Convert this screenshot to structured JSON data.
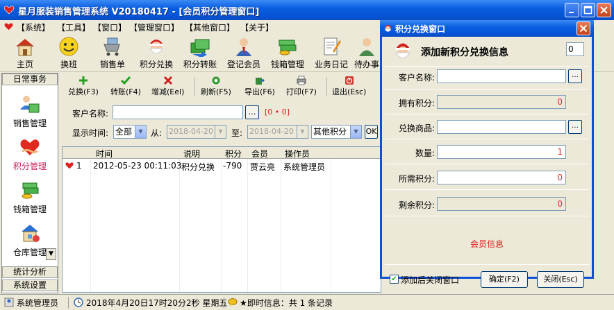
{
  "window": {
    "title": "星月服装销售管理系统 V20180417 - [会员积分管理窗口]"
  },
  "menu": [
    "【系统】",
    "【工具】",
    "【窗口】",
    "【管理窗口】",
    "【其他窗口】",
    "【关于】"
  ],
  "toolbar": [
    "主页",
    "换班",
    "销售单",
    "积分兑换",
    "积分转账",
    "登记会员",
    "钱箱管理",
    "业务日记",
    "待办事"
  ],
  "leftnav": {
    "header_top": "日常事务",
    "items": [
      "销售管理",
      "积分管理",
      "钱箱管理",
      "仓库管理"
    ],
    "footer": [
      "统计分析",
      "系统设置"
    ]
  },
  "inner_toolbar": [
    "兑换(F3)",
    "转账(F4)",
    "增减(Eel)",
    "刷新(F5)",
    "导出(F6)",
    "打印(F7)",
    "退出(Esc)"
  ],
  "filter": {
    "customer_label": "客户名称:",
    "customer_value": "",
    "points_display": "[0 • 0]",
    "time_label": "显示时间:",
    "time_option": "全部",
    "from_label": "从:",
    "from_date": "2018-04-20",
    "to_label": "至:",
    "to_date": "2018-04-20",
    "type_option": "其他积分",
    "ok_label": "OK"
  },
  "table": {
    "columns": [
      "时间",
      "说明",
      "积分",
      "会员",
      "操作员"
    ],
    "rows": [
      {
        "num": "1",
        "time": "2012-05-23 00:11:03",
        "desc": "积分兑换",
        "points": "-790",
        "member": "贾云亮",
        "operator": "系统管理员"
      }
    ]
  },
  "status": {
    "user": "系统管理员",
    "datetime": "2018年4月20日17时20分2秒 星期五",
    "info": "★即时信息：共 1 条记录"
  },
  "dialog": {
    "title": "积分兑换窗口",
    "heading": "添加新积分兑换信息",
    "heading_value": "0",
    "fields": {
      "customer": {
        "label": "客户名称:",
        "value": ""
      },
      "owned_points": {
        "label": "拥有积分:",
        "value": "0"
      },
      "product": {
        "label": "兑换商品:",
        "value": ""
      },
      "quantity": {
        "label": "数量:",
        "value": "1"
      },
      "required_points": {
        "label": "所需积分:",
        "value": "0"
      },
      "remaining_points": {
        "label": "剩余积分:",
        "value": "0"
      }
    },
    "member_info": "会员信息",
    "close_after_add": "添加后关闭窗口",
    "confirm": "确定(F2)",
    "close": "关闭(Esc)"
  }
}
